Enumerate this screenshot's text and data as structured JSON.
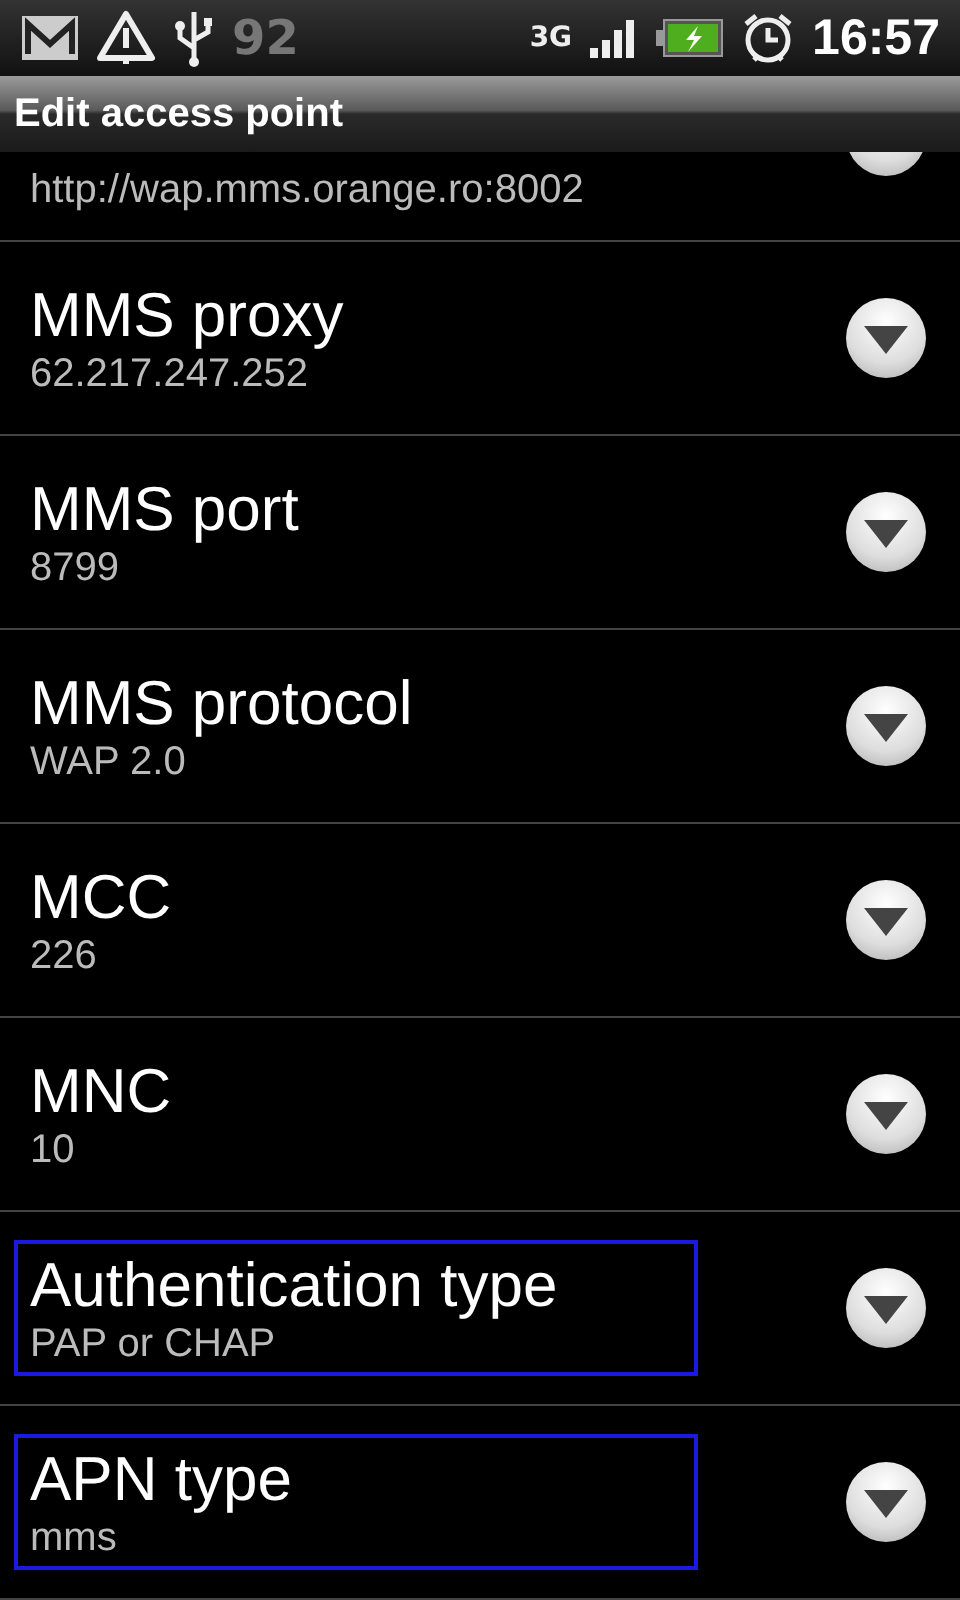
{
  "status_bar": {
    "battery_text": "92",
    "network": "3G",
    "time": "16:57"
  },
  "title": "Edit access point",
  "partial_row": {
    "summary": "http://wap.mms.orange.ro:8002"
  },
  "settings": [
    {
      "title": "MMS proxy",
      "summary": "62.217.247.252",
      "highlighted": false
    },
    {
      "title": "MMS port",
      "summary": "8799",
      "highlighted": false
    },
    {
      "title": "MMS protocol",
      "summary": "WAP 2.0",
      "highlighted": false
    },
    {
      "title": "MCC",
      "summary": "226",
      "highlighted": false
    },
    {
      "title": "MNC",
      "summary": "10",
      "highlighted": false
    },
    {
      "title": "Authentication type",
      "summary": "PAP or CHAP",
      "highlighted": true
    },
    {
      "title": "APN type",
      "summary": "mms",
      "highlighted": true
    }
  ]
}
